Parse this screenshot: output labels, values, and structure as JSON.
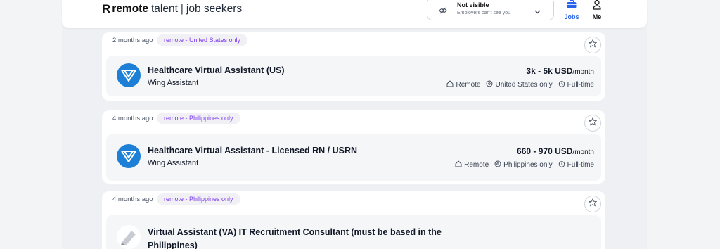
{
  "header": {
    "logo_mark": "R",
    "logo_brand": "remote",
    "logo_text": "talent",
    "logo_sep": "|",
    "logo_sub": "job seekers",
    "visibility_title": "Not visible",
    "visibility_sub": "Employers can't see you",
    "nav_jobs": "Jobs",
    "nav_me": "Me"
  },
  "colors": {
    "accent": "#2563eb",
    "pill_text": "#7c3aed",
    "avatar_blue": "#1d7fd6"
  },
  "jobs": [
    {
      "age": "2 months ago",
      "pill": "remote - United States only",
      "title": "Healthcare Virtual Assistant (US)",
      "company": "Wing Assistant",
      "salary": "3k - 5k USD",
      "salary_period": "/month",
      "tags": [
        "Remote",
        "United States only",
        "Full-time"
      ]
    },
    {
      "age": "4 months ago",
      "pill": "remote - Philippines only",
      "title": "Healthcare Virtual Assistant - Licensed RN / USRN",
      "company": "Wing Assistant",
      "salary": "660 - 970 USD",
      "salary_period": "/month",
      "tags": [
        "Remote",
        "Philippines only",
        "Full-time"
      ]
    },
    {
      "age": "4 months ago",
      "pill": "remote - Philippines only",
      "title_line1": "Virtual Assistant (VA) IT Recruitment Consultant (must be based in the",
      "title_line2": "Philippines)"
    }
  ]
}
